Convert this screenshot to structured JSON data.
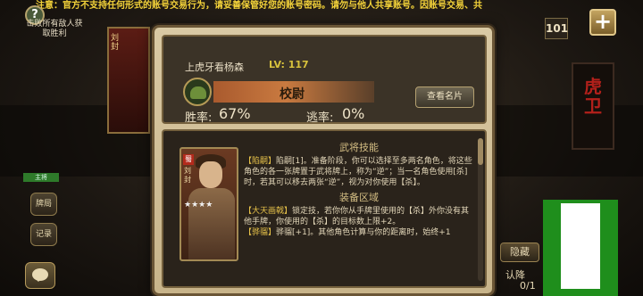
{
  "notice": "注意：官方不支持任何形式的账号交易行为，请妥善保管好您的账号密码。请勿与他人共享账号。因账号交易、共",
  "task_text": "击败所有敌人获取胜利",
  "left_card": {
    "name": "刘封"
  },
  "side_buttons": {
    "button_1": "牌局",
    "button_2": "记录"
  },
  "green_tag": "主将",
  "deck_count": "101",
  "plus_label": "+",
  "seal_text": "虎卫",
  "hide_label": "隐藏",
  "surrender_label": "认降",
  "counter": "0/1",
  "profile": {
    "name": "上虎牙看杨森",
    "level": "LV: 117",
    "rank": "校尉",
    "view_card": "查看名片",
    "win_label": "胜率:",
    "win_value": "67%",
    "flee_label": "逃率:",
    "flee_value": "0%"
  },
  "hero": {
    "kingdom": "蜀",
    "name": "刘封",
    "stars": "★★★★"
  },
  "skills": {
    "title_1": "武将技能",
    "skill_1_tag": "【陷嗣】",
    "skill_1_text": "陷嗣[1]。准备阶段，你可以选择至多两名角色，将这些角色的各一张牌置于武将牌上，称为“逆”；当一名角色使用[杀]时，若其可以移去两张“逆”，视为对你使用【杀】。",
    "title_2": "装备区域",
    "skill_2_tag": "【大天画戟】",
    "skill_2_text": "锁定技，若你你从手牌里使用的【杀】外你没有其他手牌，你使用的【杀】的目标数上限+2。",
    "skill_3_tag": "【骅骝】",
    "skill_3_text": "骅骝[+1]。其他角色计算与你的距离时，始终+1"
  },
  "colors": {
    "accent_gold": "#d8c23c",
    "rank_bar": "#c97a40",
    "notice_yellow": "#f5d43a"
  }
}
